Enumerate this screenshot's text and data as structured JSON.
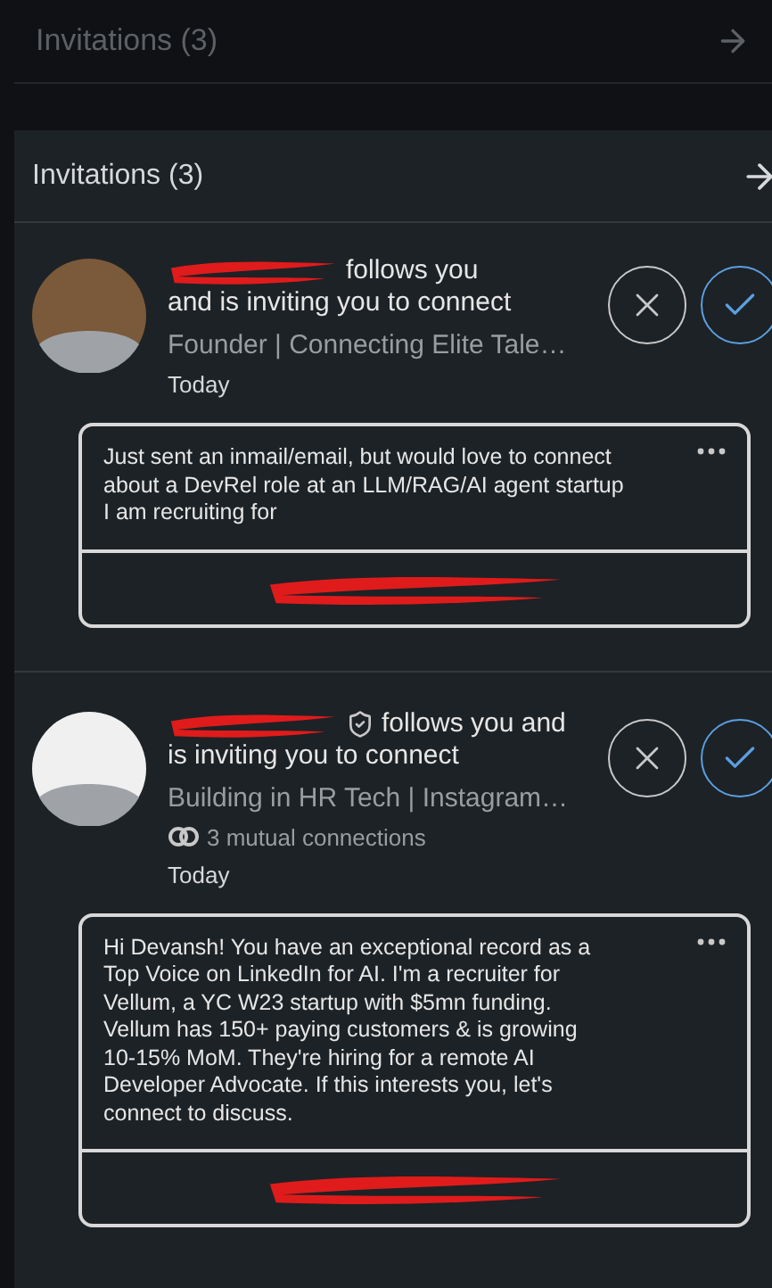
{
  "background_header": {
    "title": "Invitations (3)"
  },
  "panel": {
    "title": "Invitations (3)"
  },
  "invitations": [
    {
      "color": "#7a5a3a",
      "verified": false,
      "headline_lines": [
        "follows you",
        "and is inviting you to connect"
      ],
      "subtitle": "Founder | Connecting Elite Tale…",
      "time": "Today",
      "message": "Just sent an inmail/email, but would love to connect\nabout a DevRel role at an LLM/RAG/AI agent startup\nI am recruiting for"
    },
    {
      "color": "#f0f0f0",
      "verified": true,
      "headline_lines": [
        "follows you and",
        "is inviting you to connect"
      ],
      "subtitle": "Building in HR Tech | Instagram…",
      "mutual": "3 mutual connections",
      "time": "Today",
      "message": "Hi Devansh! You have an exceptional record as a\nTop Voice on LinkedIn for AI. I'm a recruiter for\nVellum, a YC W23 startup with $5mn funding.\nVellum has 150+ paying customers & is growing\n10-15% MoM. They're hiring for a remote AI\nDeveloper Advocate. If this interests you, let's\nconnect to discuss."
    }
  ]
}
